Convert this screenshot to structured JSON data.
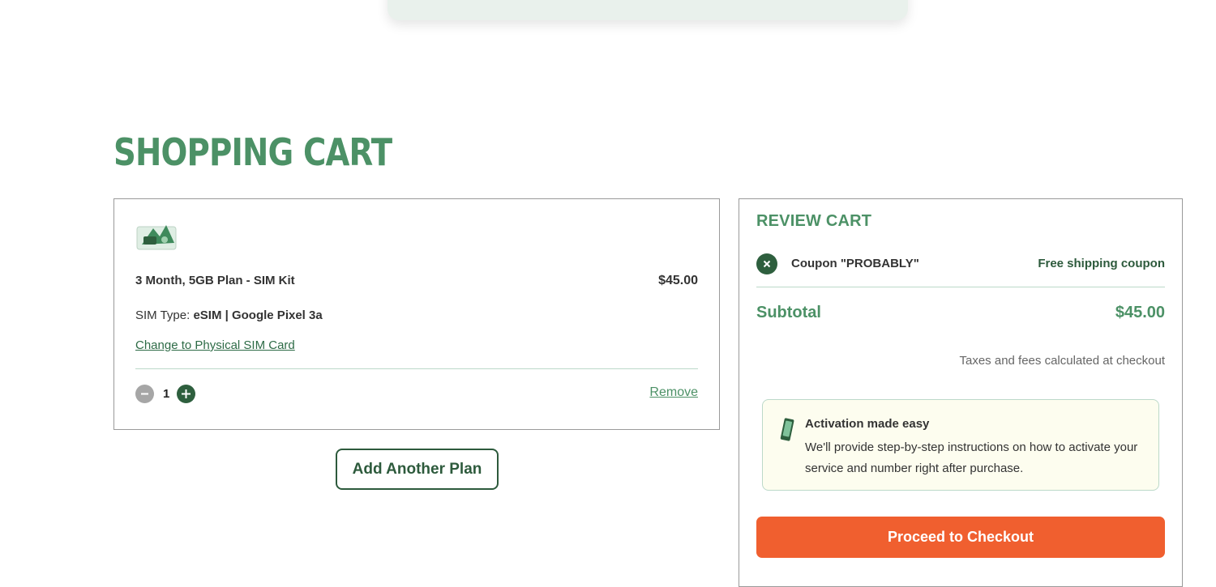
{
  "page": {
    "title": "SHOPPING CART"
  },
  "colors": {
    "brand_green": "#4c9166",
    "dark_green": "#2e5f3e",
    "checkout_orange": "#f05f2f"
  },
  "cart": {
    "item": {
      "thumbnail_icon": "sim-kit-image",
      "name": "3 Month, 5GB Plan - SIM Kit",
      "price": "$45.00",
      "sim_type_label": "SIM Type:",
      "sim_type_value": "eSIM | Google Pixel 3a",
      "change_link": "Change to Physical SIM Card",
      "quantity": "1",
      "minus_icon": "minus-icon",
      "plus_icon": "plus-icon",
      "remove_label": "Remove"
    },
    "add_plan_label": "Add Another Plan"
  },
  "review": {
    "title": "REVIEW CART",
    "coupon_icon": "close-icon",
    "coupon_label": "Coupon \"PROBABLY\"",
    "coupon_desc": "Free shipping coupon",
    "subtotal_label": "Subtotal",
    "subtotal_value": "$45.00",
    "tax_note": "Taxes and fees calculated at checkout",
    "activation": {
      "icon": "phone-icon",
      "title": "Activation made easy",
      "body": "We'll provide step-by-step instructions on how to activate your service and number right after purchase."
    },
    "checkout_label": "Proceed to Checkout"
  }
}
